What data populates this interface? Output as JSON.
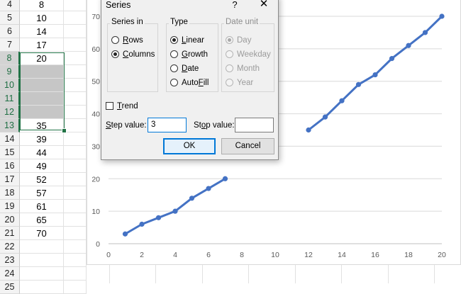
{
  "sheet": {
    "rows": [
      {
        "num": "4",
        "value": "8",
        "shaded": false
      },
      {
        "num": "5",
        "value": "10",
        "shaded": false
      },
      {
        "num": "6",
        "value": "14",
        "shaded": false
      },
      {
        "num": "7",
        "value": "17",
        "shaded": false
      },
      {
        "num": "8",
        "value": "20",
        "shaded": false
      },
      {
        "num": "9",
        "value": "",
        "shaded": true
      },
      {
        "num": "10",
        "value": "",
        "shaded": true
      },
      {
        "num": "11",
        "value": "",
        "shaded": true
      },
      {
        "num": "12",
        "value": "",
        "shaded": true
      },
      {
        "num": "13",
        "value": "35",
        "shaded": false
      },
      {
        "num": "14",
        "value": "39",
        "shaded": false
      },
      {
        "num": "15",
        "value": "44",
        "shaded": false
      },
      {
        "num": "16",
        "value": "49",
        "shaded": false
      },
      {
        "num": "17",
        "value": "52",
        "shaded": false
      },
      {
        "num": "18",
        "value": "57",
        "shaded": false
      },
      {
        "num": "19",
        "value": "61",
        "shaded": false
      },
      {
        "num": "20",
        "value": "65",
        "shaded": false
      },
      {
        "num": "21",
        "value": "70",
        "shaded": false
      },
      {
        "num": "22",
        "value": "",
        "shaded": false
      },
      {
        "num": "23",
        "value": "",
        "shaded": false
      },
      {
        "num": "24",
        "value": "",
        "shaded": false
      },
      {
        "num": "25",
        "value": "",
        "shaded": false
      }
    ],
    "selected_rows": [
      "8",
      "9",
      "10",
      "11",
      "12",
      "13"
    ],
    "selection_color": "#217346"
  },
  "chart_data": {
    "type": "line",
    "xlim": [
      0,
      20
    ],
    "ylim": [
      0,
      70
    ],
    "x_ticks": [
      "0",
      "2",
      "4",
      "6",
      "8",
      "10",
      "12",
      "14",
      "16",
      "18",
      "20"
    ],
    "y_ticks": [
      "0",
      "10",
      "20",
      "30",
      "40",
      "50",
      "60",
      "70"
    ],
    "grid": true,
    "legend": "none",
    "color": "#4472c4",
    "series": [
      {
        "points": [
          [
            1,
            3
          ],
          [
            2,
            6
          ],
          [
            3,
            8
          ],
          [
            4,
            10
          ],
          [
            5,
            14
          ],
          [
            6,
            17
          ],
          [
            7,
            20
          ],
          [
            12,
            35
          ],
          [
            13,
            39
          ],
          [
            14,
            44
          ],
          [
            15,
            49
          ],
          [
            16,
            52
          ],
          [
            17,
            57
          ],
          [
            18,
            61
          ],
          [
            19,
            65
          ],
          [
            20,
            70
          ]
        ],
        "segments": [
          [
            [
              1,
              3
            ],
            [
              2,
              6
            ],
            [
              3,
              8
            ],
            [
              4,
              10
            ],
            [
              5,
              14
            ],
            [
              6,
              17
            ],
            [
              7,
              20
            ]
          ],
          [
            [
              12,
              35
            ],
            [
              13,
              39
            ],
            [
              14,
              44
            ],
            [
              15,
              49
            ],
            [
              16,
              52
            ],
            [
              17,
              57
            ],
            [
              18,
              61
            ],
            [
              19,
              65
            ],
            [
              20,
              70
            ]
          ]
        ]
      }
    ]
  },
  "dialog": {
    "title": "Series",
    "help": "?",
    "close": "✕",
    "series_in": {
      "title": "Series in",
      "options": [
        {
          "pre": "",
          "key": "R",
          "post": "ows",
          "checked": false
        },
        {
          "pre": "",
          "key": "C",
          "post": "olumns",
          "checked": true
        }
      ]
    },
    "type": {
      "title": "Type",
      "options": [
        {
          "pre": "",
          "key": "L",
          "post": "inear",
          "checked": true
        },
        {
          "pre": "",
          "key": "G",
          "post": "rowth",
          "checked": false
        },
        {
          "pre": "",
          "key": "D",
          "post": "ate",
          "checked": false
        },
        {
          "pre": "Auto",
          "key": "F",
          "post": "ill",
          "checked": false
        }
      ]
    },
    "date_unit": {
      "title": "Date unit",
      "options": [
        {
          "label": "Day",
          "checked": true
        },
        {
          "label": "Weekday",
          "checked": false
        },
        {
          "label": "Month",
          "checked": false
        },
        {
          "label": "Year",
          "checked": false
        }
      ]
    },
    "trend": {
      "key": "T",
      "post": "rend",
      "checked": false
    },
    "step": {
      "pre": "",
      "key": "S",
      "post": "tep value:",
      "value": "3"
    },
    "stop": {
      "pre": "St",
      "key": "o",
      "post": "p value:",
      "value": ""
    },
    "ok_label": "OK",
    "cancel_label": "Cancel",
    "focus_color": "#0078d7"
  }
}
